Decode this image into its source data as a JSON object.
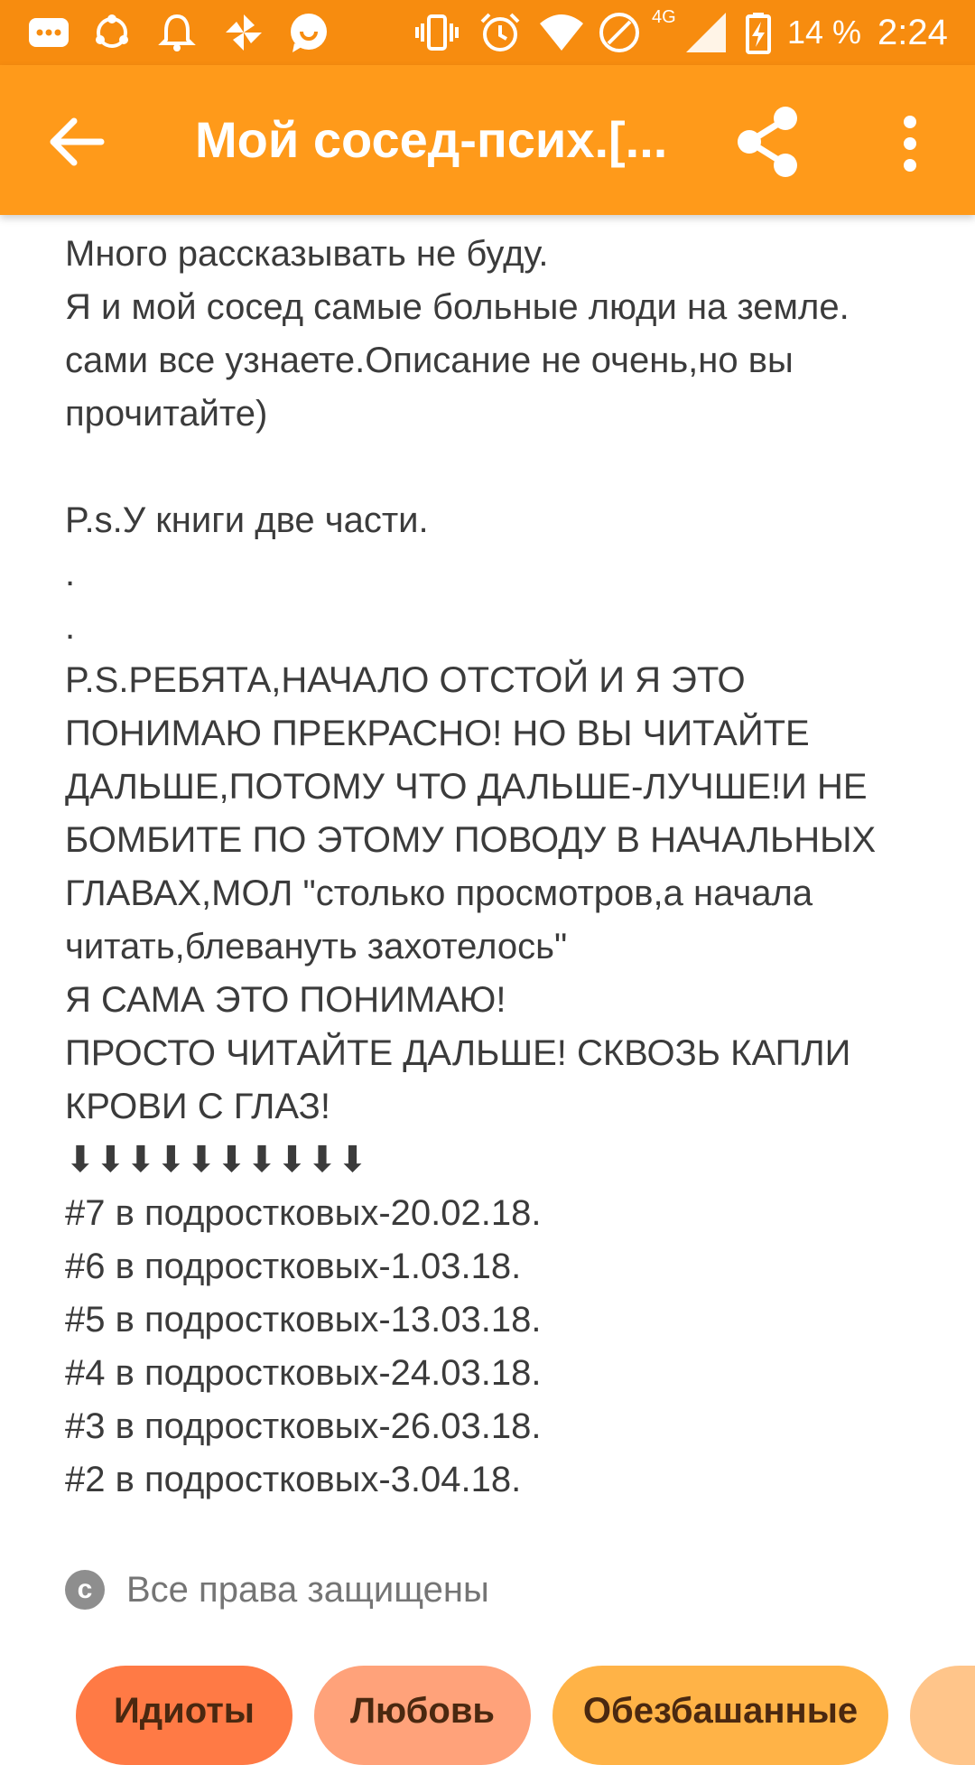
{
  "status_bar": {
    "network": "4G",
    "battery": "14 %",
    "time": "2:24",
    "icons": [
      "messages-icon",
      "sync-icon",
      "bell-icon",
      "pinwheel-icon",
      "chat-icon",
      "vibrate-icon",
      "alarm-icon",
      "wifi-icon",
      "dnd-icon",
      "signal-icon",
      "battery-icon"
    ]
  },
  "app_bar": {
    "title": "Мой сосед-псих.[...",
    "back_icon": "arrow-left-icon",
    "share_icon": "share-icon",
    "more_icon": "more-vert-icon"
  },
  "description": {
    "lines": [
      "Много рассказывать не буду.",
      "Я и мой сосед самые больные люди на земле.",
      "сами все узнаете.Описание не очень,но вы",
      "прочитайте)",
      "",
      "P.s.У книги две части.",
      ".",
      ".",
      "P.S.РЕБЯТА,НАЧАЛО ОТСТОЙ И Я ЭТО",
      "ПОНИМАЮ ПРЕКРАСНО! НО ВЫ ЧИТАЙТЕ",
      "ДАЛЬШЕ,ПОТОМУ ЧТО ДАЛЬШЕ-ЛУЧШЕ!И НЕ",
      "БОМБИТЕ ПО ЭТОМУ ПОВОДУ В НАЧАЛЬНЫХ",
      "ГЛАВАХ,МОЛ \"столько просмотров,а начала",
      "читать,блевануть захотелось\"",
      "Я САМА ЭТО ПОНИМАЮ!",
      "ПРОСТО ЧИТАЙТЕ ДАЛЬШЕ! СКВОЗЬ КАПЛИ",
      "КРОВИ С ГЛАЗ!",
      "⬇⬇⬇⬇⬇⬇⬇⬇⬇⬇",
      "#7 в подростковых-20.02.18.",
      "#6 в подростковых-1.03.18.",
      "#5 в подростковых-13.03.18.",
      "#4 в подростковых-24.03.18.",
      "#3 в подростковых-26.03.18.",
      "#2 в подростковых-3.04.18."
    ]
  },
  "copyright": {
    "symbol": "c",
    "text": "Все права защищены"
  },
  "tags": [
    {
      "label": "Идиоты",
      "color": "#ff7a45"
    },
    {
      "label": "Любовь",
      "color": "#ffa27a"
    },
    {
      "label": "Обезбашанные",
      "color": "#ffb347"
    },
    {
      "label": "",
      "color": "#ffc58a"
    }
  ]
}
